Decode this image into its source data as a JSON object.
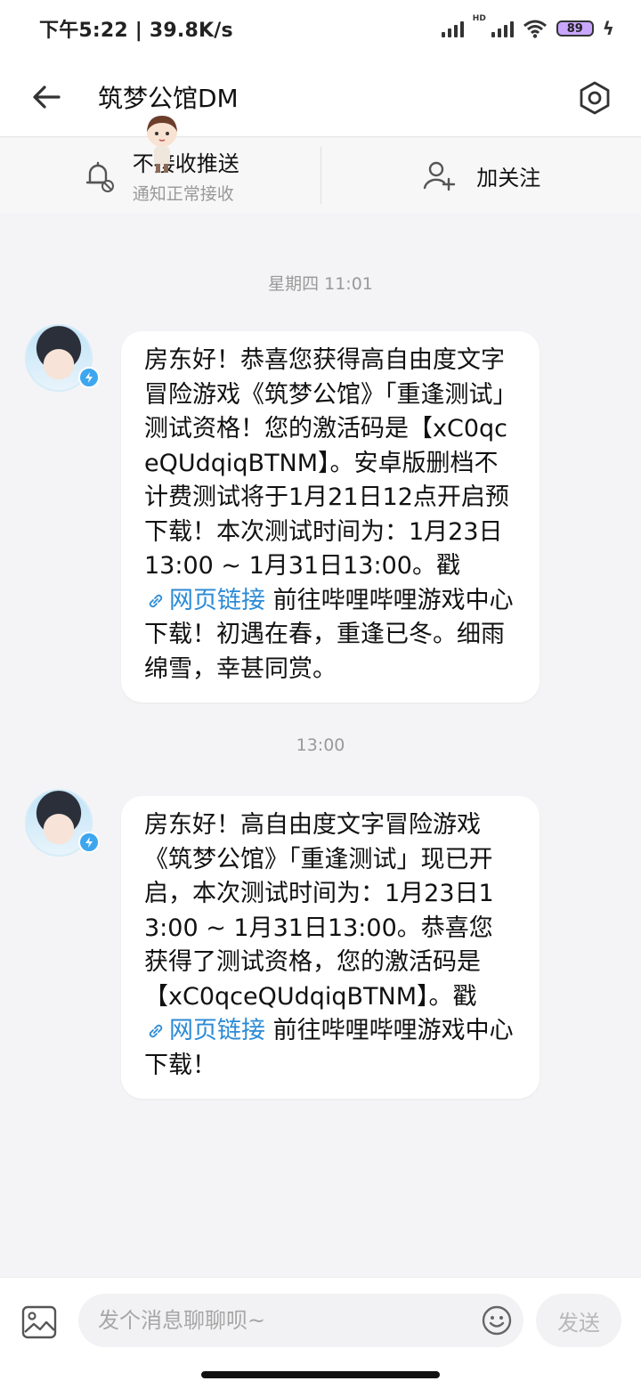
{
  "status_bar": {
    "time_speed": "下午5:22 | 39.8K/s",
    "hd_label": "HD",
    "battery": "89"
  },
  "header": {
    "title": "筑梦公馆DM"
  },
  "actions": {
    "mute": {
      "label": "不接收推送",
      "sub": "通知正常接收"
    },
    "follow": {
      "label": "加关注"
    }
  },
  "messages": [
    {
      "timestamp": "星期四 11:01",
      "text_before": "房东好！恭喜您获得高自由度文字冒险游戏《筑梦公馆》「重逢测试」测试资格！您的激活码是【xC0qceQUdqiqBTNM】。安卓版删档不计费测试将于1月21日12点开启预下载！本次测试时间为：1月23日13:00 ~ 1月31日13:00。戳",
      "link_text": "网页链接",
      "text_after": "前往哔哩哔哩游戏中心下载！初遇在春，重逢已冬。细雨绵雪，幸甚同赏。"
    },
    {
      "timestamp": "13:00",
      "text_before": "房东好！高自由度文字冒险游戏《筑梦公馆》「重逢测试」现已开启，本次测试时间为：1月23日13:00 ~ 1月31日13:00。恭喜您获得了测试资格，您的激活码是【xC0qceQUdqiqBTNM】。戳",
      "link_text": "网页链接",
      "text_after": "前往哔哩哔哩游戏中心下载！"
    }
  ],
  "input_bar": {
    "placeholder": "发个消息聊聊呗~",
    "send_label": "发送"
  },
  "colors": {
    "link": "#2b8ad6",
    "verified_badge": "#3ea6ef",
    "background": "#f4f4f6"
  },
  "icons": [
    "back-arrow-icon",
    "settings-hexagon-icon",
    "bell-muted-icon",
    "add-user-icon",
    "link-icon",
    "image-icon",
    "emoji-icon",
    "verified-icon"
  ]
}
